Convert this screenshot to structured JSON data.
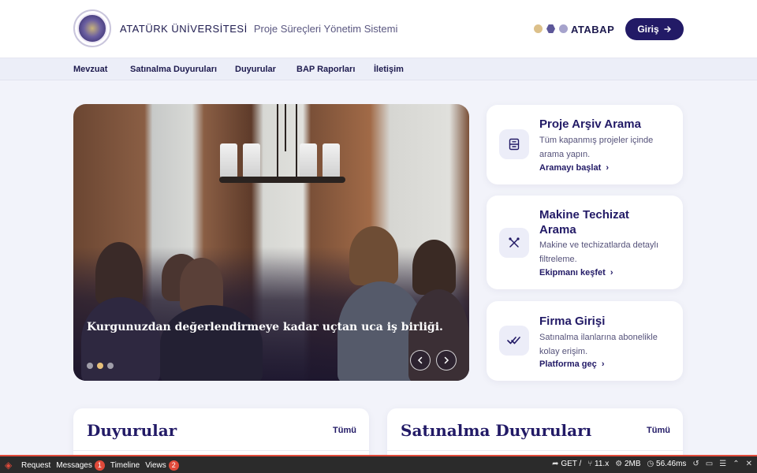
{
  "header": {
    "university": "ATATÜRK ÜNİVERSİTESİ",
    "subtitle": "Proje Süreçleri Yönetim Sistemi",
    "brand": "ATABAP",
    "login_label": "Giriş",
    "login_icon": "arrow-right-icon",
    "brand_colors": [
      "#dcc08a",
      "#5c5799",
      "#a6a3cc"
    ]
  },
  "nav": {
    "items": [
      {
        "label": "Mevzuat"
      },
      {
        "label": "Satınalma Duyuruları"
      },
      {
        "label": "Duyurular"
      },
      {
        "label": "BAP Raporları"
      },
      {
        "label": "İletişim"
      }
    ]
  },
  "hero": {
    "caption": "Kurgunuzdan değerlendirmeye kadar uçtan uca iş birliği.",
    "slide_count": 3,
    "active_slide": 2,
    "prev_icon": "chevron-left-icon",
    "next_icon": "chevron-right-icon"
  },
  "cards": [
    {
      "icon": "archive-icon",
      "title": "Proje Arşiv Arama",
      "description": "Tüm kapanmış projeler içinde arama yapın.",
      "link": "Aramayı başlat"
    },
    {
      "icon": "tools-icon",
      "title": "Makine Techizat Arama",
      "description": "Makine ve techizatlarda detaylı filtreleme.",
      "link": "Ekipmanı keşfet"
    },
    {
      "icon": "double-check-icon",
      "title": "Firma Girişi",
      "description": "Satınalma ilanlarına abonelikle kolay erişim.",
      "link": "Platforma geç"
    }
  ],
  "panels": [
    {
      "title": "Duyurular",
      "all_label": "Tümü"
    },
    {
      "title": "Satınalma Duyuruları",
      "all_label": "Tümü"
    }
  ],
  "debugbar": {
    "tabs": [
      {
        "label": "Request",
        "badge": ""
      },
      {
        "label": "Messages",
        "badge": "1"
      },
      {
        "label": "Timeline",
        "badge": ""
      },
      {
        "label": "Views",
        "badge": "2"
      }
    ],
    "method": "GET /",
    "version": "11.x",
    "memory": "2MB",
    "time": "56.46ms",
    "accent": "#e04a3a"
  }
}
